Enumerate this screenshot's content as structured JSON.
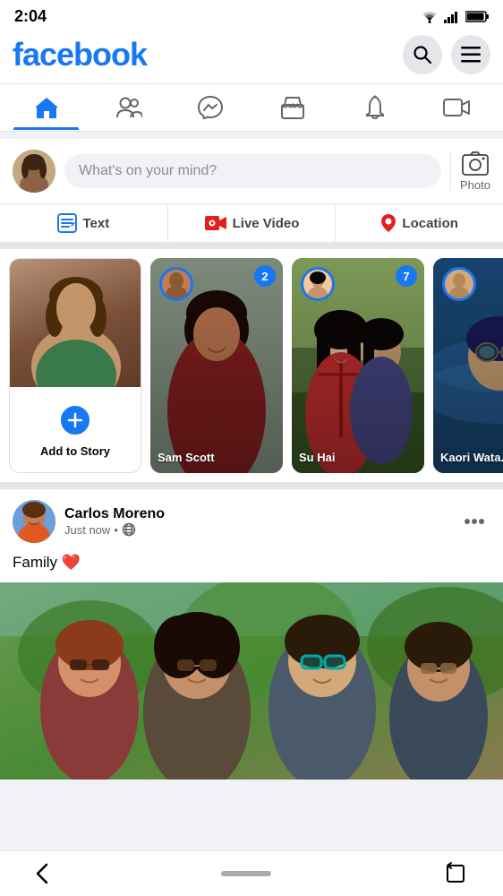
{
  "status": {
    "time": "2:04",
    "wifi_icon": "wifi",
    "signal_icon": "signal",
    "battery_icon": "battery"
  },
  "header": {
    "logo": "facebook",
    "search_label": "search",
    "menu_label": "menu"
  },
  "nav": {
    "items": [
      {
        "label": "Home",
        "icon": "home",
        "active": true
      },
      {
        "label": "Friends",
        "icon": "friends"
      },
      {
        "label": "Messenger",
        "icon": "messenger"
      },
      {
        "label": "Marketplace",
        "icon": "marketplace"
      },
      {
        "label": "Notifications",
        "icon": "notifications"
      },
      {
        "label": "Video",
        "icon": "video"
      }
    ]
  },
  "composer": {
    "placeholder": "What's on your mind?",
    "photo_label": "Photo"
  },
  "actions": {
    "text_label": "Text",
    "live_video_label": "Live Video",
    "location_label": "Location"
  },
  "stories": {
    "add_label": "Add to Story",
    "items": [
      {
        "name": "Sam Scott",
        "badge": "2",
        "color1": "#5a6e5a",
        "color2": "#3d4a3d"
      },
      {
        "name": "Su Hai",
        "badge": "7",
        "color1": "#7a8f6e",
        "color2": "#2a3520"
      },
      {
        "name": "Kaori Wata...",
        "badge": "",
        "color1": "#4a6e8f",
        "color2": "#1a3050"
      }
    ]
  },
  "post": {
    "user_name": "Carlos Moreno",
    "meta": "Just now",
    "privacy_icon": "globe",
    "text": "Family ❤️",
    "more_icon": "ellipsis"
  },
  "bottom_nav": {
    "back_label": "back",
    "home_indicator": "home-indicator",
    "rotate_label": "rotate"
  }
}
